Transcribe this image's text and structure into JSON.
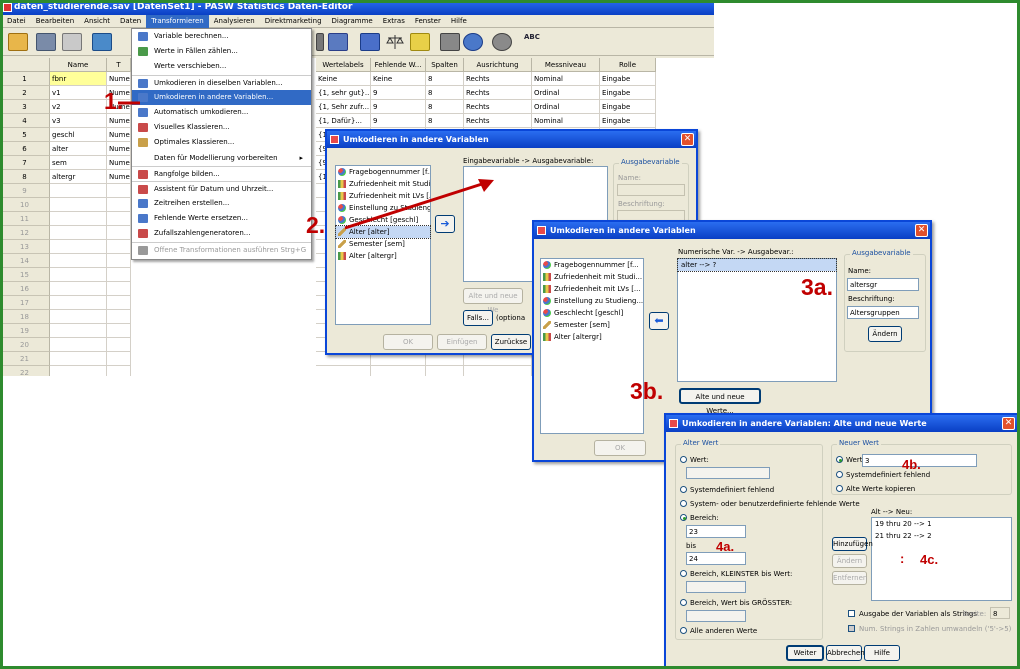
{
  "main_window": {
    "title": "daten_studierende.sav [DatenSet1] - PASW Statistics Daten-Editor",
    "menu": [
      "Datei",
      "Bearbeiten",
      "Ansicht",
      "Daten",
      "Transformieren",
      "Analysieren",
      "Direktmarketing",
      "Diagramme",
      "Extras",
      "Fenster",
      "Hilfe"
    ],
    "toolbar_spell": "ABC"
  },
  "grid": {
    "columns": [
      "Name",
      "T",
      "Wertelabels",
      "Fehlende W...",
      "Spalten",
      "Ausrichtung",
      "Messniveau",
      "Rolle"
    ],
    "rows": [
      {
        "n": "1",
        "name": "fbnr",
        "type": "Numer",
        "labels": "Keine",
        "missing": "Keine",
        "cols": "8",
        "align": "Rechts",
        "measure": "Nominal",
        "role": "Eingabe"
      },
      {
        "n": "2",
        "name": "v1",
        "type": "Numer",
        "labels": "{1, sehr gut}...",
        "missing": "9",
        "cols": "8",
        "align": "Rechts",
        "measure": "Ordinal",
        "role": "Eingabe"
      },
      {
        "n": "3",
        "name": "v2",
        "type": "Numer",
        "labels": "{1, Sehr zufr...",
        "missing": "9",
        "cols": "8",
        "align": "Rechts",
        "measure": "Ordinal",
        "role": "Eingabe"
      },
      {
        "n": "4",
        "name": "v3",
        "type": "Numer",
        "labels": "{1, Dafür}...",
        "missing": "9",
        "cols": "8",
        "align": "Rechts",
        "measure": "Nominal",
        "role": "Eingabe"
      },
      {
        "n": "5",
        "name": "geschl",
        "type": "Numer",
        "labels": "{1",
        "missing": "",
        "cols": "",
        "align": "",
        "measure": "",
        "role": ""
      },
      {
        "n": "6",
        "name": "alter",
        "type": "Numer",
        "labels": "{9",
        "missing": "",
        "cols": "",
        "align": "",
        "measure": "",
        "role": ""
      },
      {
        "n": "7",
        "name": "sem",
        "type": "Numer",
        "labels": "{9",
        "missing": "",
        "cols": "",
        "align": "",
        "measure": "",
        "role": ""
      },
      {
        "n": "8",
        "name": "altergr",
        "type": "Numer",
        "labels": "{1",
        "missing": "",
        "cols": "",
        "align": "",
        "measure": "",
        "role": ""
      }
    ],
    "empty_rows": [
      "9",
      "10",
      "11",
      "12",
      "13",
      "14",
      "15",
      "16",
      "17",
      "18",
      "19",
      "20",
      "21",
      "22"
    ]
  },
  "transform_menu": {
    "items": [
      {
        "label": "Variable berechnen...",
        "icon": "calc-icon",
        "color": "#4a78c9"
      },
      {
        "label": "Werte in Fällen zählen...",
        "icon": "count-icon",
        "color": "#4a9a4a"
      },
      {
        "label": "Werte verschieben...",
        "icon": "none",
        "color": ""
      },
      {
        "label": "Umkodieren in dieselben Variablen...",
        "icon": "recode-same-icon",
        "color": "#4a78c9"
      },
      {
        "label": "Umkodieren in andere Variablen...",
        "icon": "recode-other-icon",
        "color": "#4a78c9"
      },
      {
        "label": "Automatisch umkodieren...",
        "icon": "auto-recode-icon",
        "color": "#4a78c9"
      },
      {
        "label": "Visuelles Klassieren...",
        "icon": "visual-bin-icon",
        "color": "#c94a4a"
      },
      {
        "label": "Optimales Klassieren...",
        "icon": "optimal-bin-icon",
        "color": "#c9a04a"
      },
      {
        "label": "Daten für Modellierung vorbereiten",
        "icon": "none",
        "color": "",
        "submenu": "▸"
      },
      {
        "label": "Rangfolge bilden...",
        "icon": "rank-icon",
        "color": "#c94a4a"
      },
      {
        "label": "Assistent für Datum und Uhrzeit...",
        "icon": "datetime-icon",
        "color": "#c94a4a"
      },
      {
        "label": "Zeitreihen erstellen...",
        "icon": "timeseries-icon",
        "color": "#4a78c9"
      },
      {
        "label": "Fehlende Werte ersetzen...",
        "icon": "missing-values-icon",
        "color": "#4a78c9"
      },
      {
        "label": "Zufallszahlengeneratoren...",
        "icon": "random-icon",
        "color": "#c94a4a"
      },
      {
        "label": "Offene Transformationen ausführen Strg+G",
        "icon": "run-icon",
        "color": "#999999",
        "disabled": true
      }
    ]
  },
  "dialog1": {
    "title": "Umkodieren in andere Variablen",
    "listbox_label": "Eingabevariable -> Ausgabevariable:",
    "variables": [
      {
        "label": "Fragebogennummer [f...",
        "type": "nominal"
      },
      {
        "label": "Zufriedenheit mit Studi...",
        "type": "ordinal"
      },
      {
        "label": "Zufriedenheit mit LVs [...",
        "type": "ordinal"
      },
      {
        "label": "Einstellung zu Studieng...",
        "type": "nominal"
      },
      {
        "label": "Geschlecht [geschl]",
        "type": "nominal"
      },
      {
        "label": "Alter [alter]",
        "type": "scale"
      },
      {
        "label": "Semester [sem]",
        "type": "scale"
      },
      {
        "label": "Alter [altergr]",
        "type": "ordinal"
      }
    ],
    "group_title": "Ausgabevariable",
    "name_label": "Name:",
    "label_label": "Beschriftung:",
    "old_new_button": "Alte und neue We",
    "if_button": "Falls...",
    "if_optional": "(optiona",
    "ok": "OK",
    "paste": "Einfügen",
    "reset": "Zurückse"
  },
  "dialog2": {
    "title": "Umkodieren in andere Variablen",
    "list_label": "Numerische Var. -> Ausgabevar.:",
    "mapping": "alter --> ?",
    "variables": [
      {
        "label": "Fragebogennummer [f...",
        "type": "nominal"
      },
      {
        "label": "Zufriedenheit mit Studi...",
        "type": "ordinal"
      },
      {
        "label": "Zufriedenheit mit LVs [...",
        "type": "ordinal"
      },
      {
        "label": "Einstellung zu Studieng...",
        "type": "nominal"
      },
      {
        "label": "Geschlecht [geschl]",
        "type": "nominal"
      },
      {
        "label": "Semester [sem]",
        "type": "scale"
      },
      {
        "label": "Alter [altergr]",
        "type": "ordinal"
      }
    ],
    "group_title": "Ausgabevariable",
    "name_label": "Name:",
    "name_value": "altersgr",
    "label_label": "Beschriftung:",
    "label_value": "Altersgruppen",
    "change_button": "Ändern",
    "old_new_button": "Alte und neue Werte...",
    "ok": "OK"
  },
  "dialog3": {
    "title": "Umkodieren in andere Variablen: Alte und neue Werte",
    "old_group": "Alter Wert",
    "new_group": "Neuer Wert",
    "old_value": "Wert:",
    "system_missing": "Systemdefiniert fehlend",
    "system_user_missing": "System- oder benutzerdefinierte fehlende Werte",
    "range": "Bereich:",
    "range_from": "23",
    "range_to_label": "bis",
    "range_to": "24",
    "lowest_through": "Bereich, KLEINSTER bis Wert:",
    "through_highest": "Bereich, Wert bis GRÖSSTER:",
    "all_other": "Alle anderen Werte",
    "new_value_label": "Wert:",
    "new_value": "3",
    "new_system_missing": "Systemdefiniert fehlend",
    "copy_old": "Alte Werte kopieren",
    "old_new_label": "Alt --> Neu:",
    "mappings": [
      "19 thru 20 --> 1",
      "21 thru 22 --> 2"
    ],
    "add": "Hinzufügen",
    "change": "Ändern",
    "remove": "Entfernen",
    "strings_check": "Ausgabe der Variablen als Strings",
    "width_label": "Breite:",
    "width_value": "8",
    "convert_check": "Num. Strings in Zahlen umwandeln ('5'->5)",
    "continue": "Weiter",
    "cancel": "Abbrechen",
    "help": "Hilfe"
  },
  "annotations": {
    "a1": "1.",
    "a2": "2.",
    "a3a": "3a.",
    "a3b": "3b.",
    "a4a": "4a.",
    "a4b": "4b.",
    "a4c": "4c.",
    "dots": ":"
  },
  "colors": {
    "xp_title": "#0a3fc4",
    "selection": "#316ac5",
    "annotation": "#c00000",
    "frame": "#2e8b2e"
  }
}
